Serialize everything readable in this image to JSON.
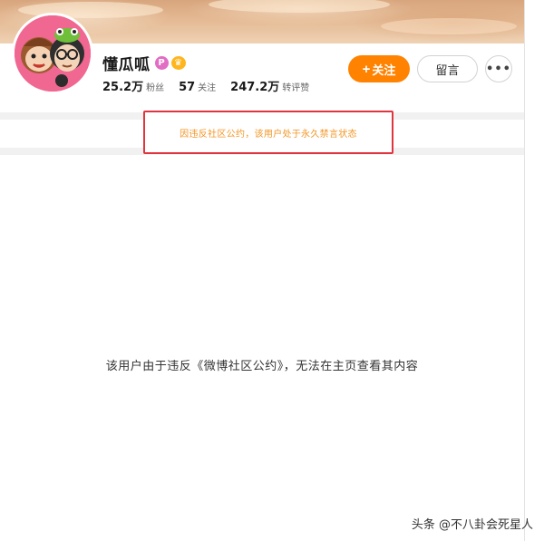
{
  "profile": {
    "name": "懂瓜呱",
    "badge_p": "P",
    "badge_crown": "♛"
  },
  "stats": [
    {
      "value": "25.2万",
      "label": "粉丝"
    },
    {
      "value": "57",
      "label": "关注"
    },
    {
      "value": "247.2万",
      "label": "转评赞"
    }
  ],
  "actions": {
    "follow_plus": "+",
    "follow_label": "关注",
    "message_label": "留言",
    "more_label": "•••"
  },
  "notice": "因违反社区公约，该用户处于永久禁言状态",
  "main_message": "该用户由于违反《微博社区公约》，无法在主页查看其内容",
  "watermark": "头条 @不八卦会死星人",
  "colors": {
    "accent": "#ff8200",
    "notice_text": "#f39523",
    "highlight_border": "#e0343f"
  }
}
